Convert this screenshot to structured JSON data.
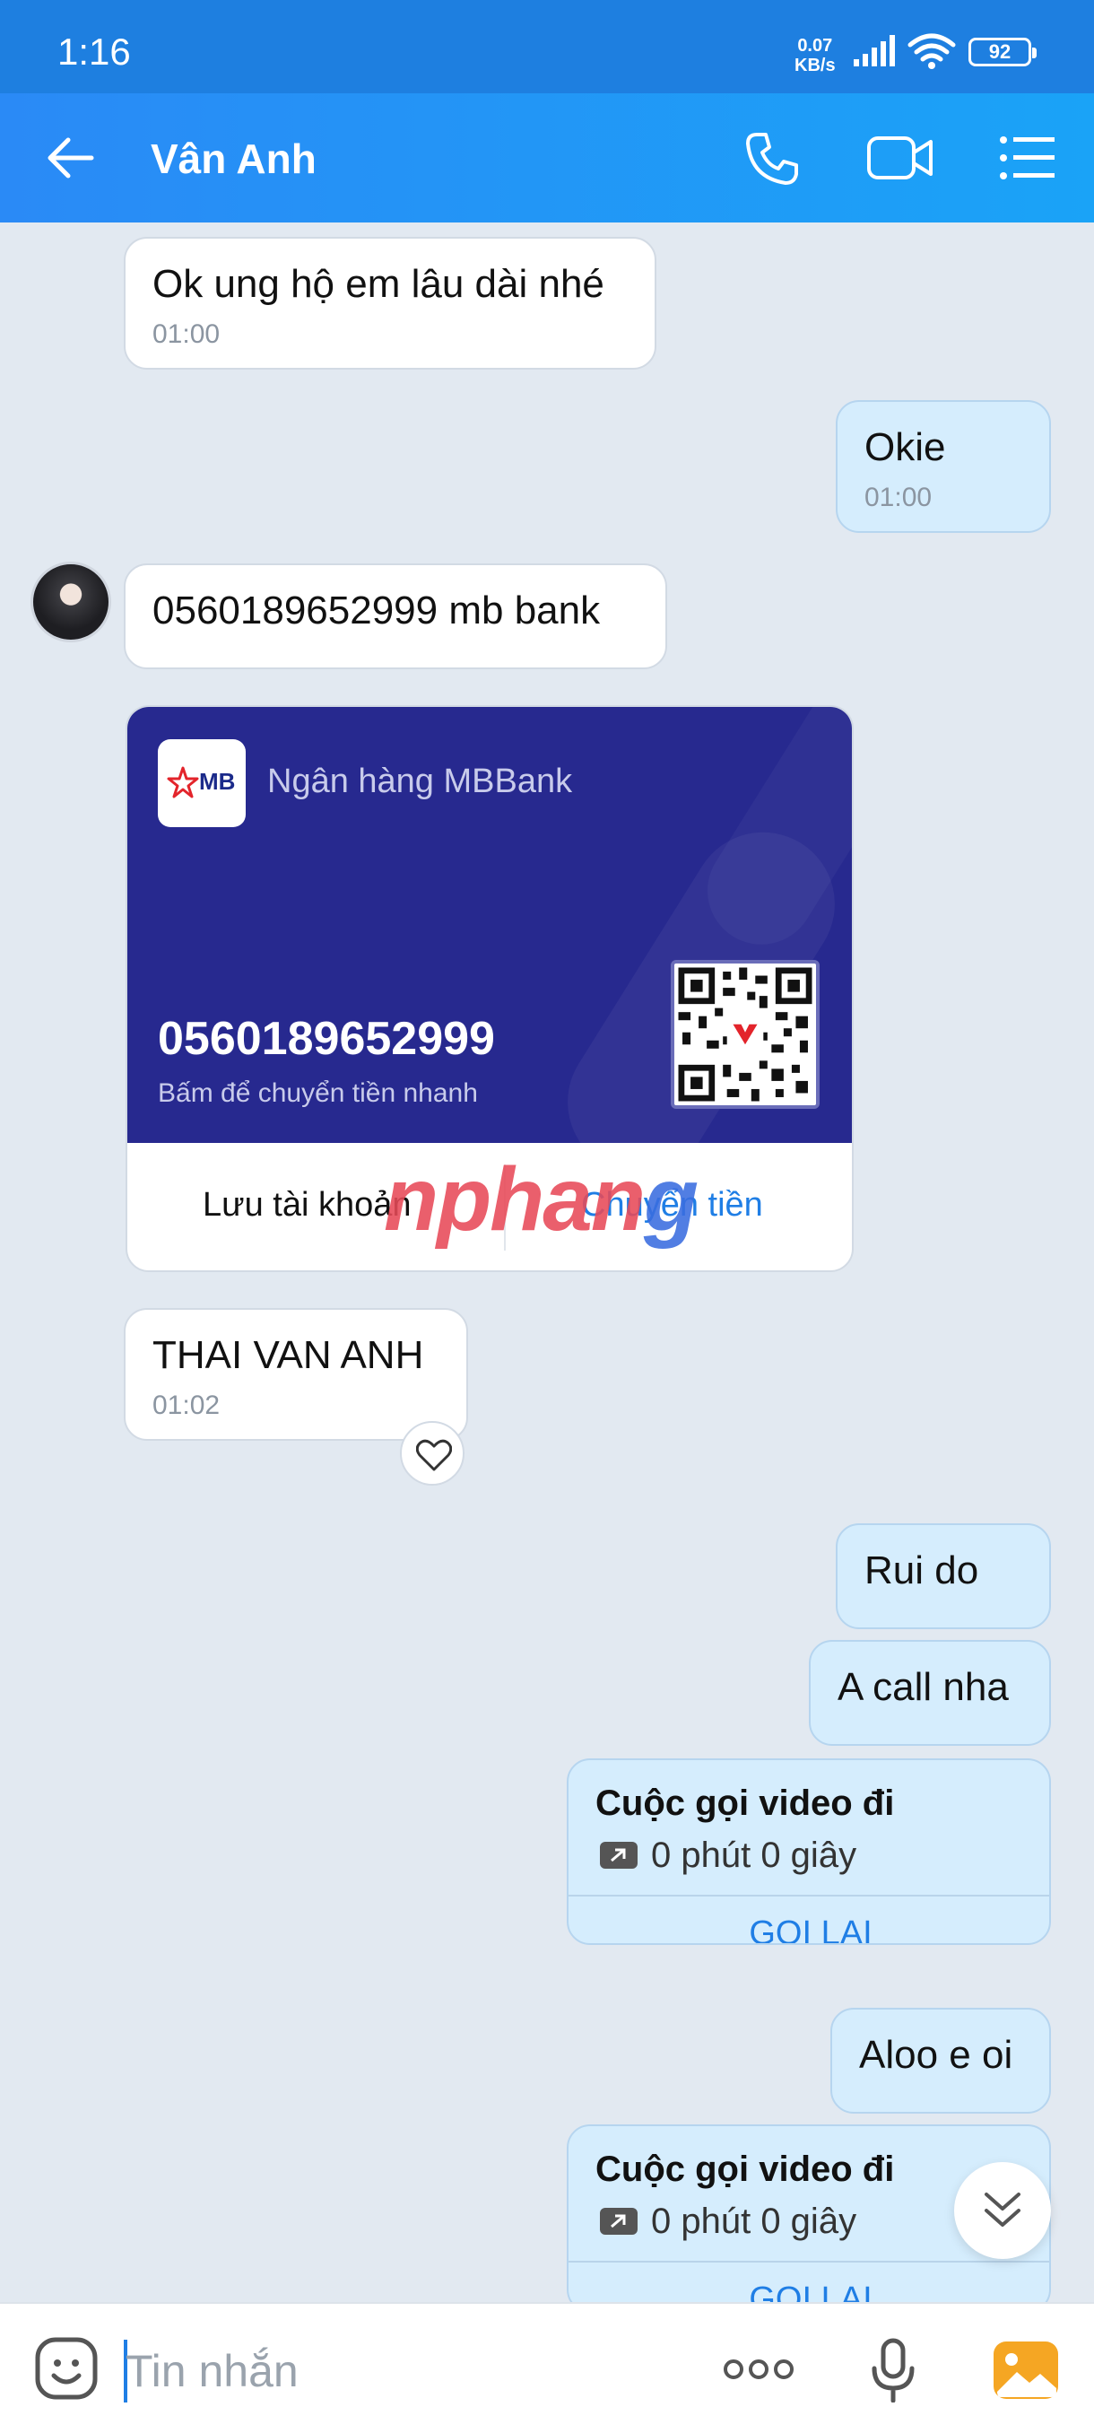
{
  "status_bar": {
    "time": "1:16",
    "speed_value": "0.07",
    "speed_unit": "KB/s",
    "battery": "92"
  },
  "header": {
    "title": "Vân Anh"
  },
  "messages": [
    {
      "text": "Ok ung hộ em lâu dài nhé",
      "time": "01:00"
    },
    {
      "text": "Okie",
      "time": "01:00"
    },
    {
      "text": "0560189652999 mb bank"
    },
    {
      "text": "THAI VAN ANH",
      "time": "01:02"
    },
    {
      "text": "Rui do"
    },
    {
      "text": "A call nha"
    },
    {
      "text": "Aloo e oi"
    }
  ],
  "bank_card": {
    "logo_text": "MB",
    "bank_name": "Ngân hàng MBBank",
    "account_number": "0560189652999",
    "hint": "Bấm để chuyển tiền nhanh",
    "save_label": "Lưu tài khoản",
    "transfer_label": "Chuyển tiền"
  },
  "watermark": {
    "part1": "nphan",
    "part2": "g"
  },
  "calls": [
    {
      "title": "Cuộc gọi video đi",
      "duration": "0 phút 0 giây",
      "action": "GỌI LẠI"
    },
    {
      "title": "Cuộc gọi video đi",
      "duration": "0 phút 0 giây",
      "action": "GỌI LẠI"
    }
  ],
  "input": {
    "placeholder": "Tin nhắn"
  },
  "colors": {
    "header": "#1e7fe0",
    "card": "#27298f",
    "accent": "#1f7ee5",
    "bubble_out": "#d5edfd"
  }
}
